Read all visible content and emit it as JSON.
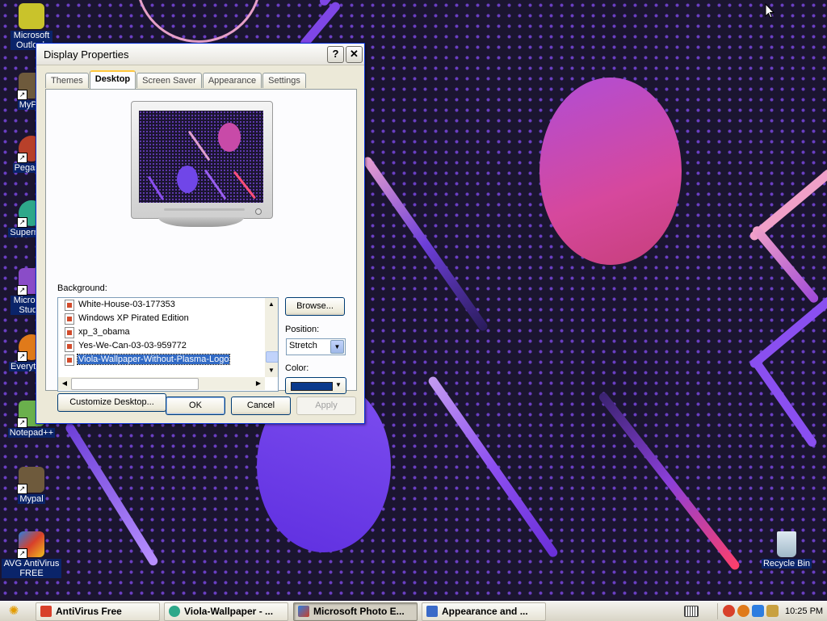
{
  "desktop": {
    "icons": [
      {
        "label": "Microsoft Outlook",
        "color": "#c9c32b"
      },
      {
        "label": "MyPal",
        "color": "#6e5a3c"
      },
      {
        "label": "Pegasus",
        "color": "#b8402a"
      },
      {
        "label": "Supernova",
        "color": "#2ea88a"
      },
      {
        "label": "Microsoft Studio",
        "color": "#8a4cc8"
      },
      {
        "label": "Everything",
        "color": "#e07a1a"
      },
      {
        "label": "Notepad++",
        "color": "#6ab04c"
      },
      {
        "label": "Mypal",
        "color": "#6e5a3c"
      },
      {
        "label": "AVG AntiVirus FREE",
        "color": "#d8402a"
      },
      {
        "label": "Recycle Bin",
        "color": "#9fb8c8"
      }
    ]
  },
  "dialog": {
    "title": "Display Properties",
    "help_glyph": "?",
    "close_glyph": "✕",
    "tabs": [
      "Themes",
      "Desktop",
      "Screen Saver",
      "Appearance",
      "Settings"
    ],
    "active_tab": "Desktop",
    "background_label": "Background:",
    "backgrounds": [
      "White-House-03-177353",
      "Windows XP Pirated Edition",
      "xp_3_obama",
      "Yes-We-Can-03-03-959772",
      "Viola-Wallpaper-Without-Plasma-Logo"
    ],
    "selected_background": "Viola-Wallpaper-Without-Plasma-Logo",
    "browse_label": "Browse...",
    "position_label": "Position:",
    "position_value": "Stretch",
    "color_label": "Color:",
    "color_value": "#0a3a8c",
    "customize_label": "Customize Desktop...",
    "ok_label": "OK",
    "cancel_label": "Cancel",
    "apply_label": "Apply"
  },
  "taskbar": {
    "tasks": [
      {
        "label": "AntiVirus Free",
        "active": false,
        "icon": "#d8402a"
      },
      {
        "label": "Viola-Wallpaper - ...",
        "active": false,
        "icon": "#2ea88a"
      },
      {
        "label": "Microsoft Photo E...",
        "active": true,
        "icon": "#c8402a"
      },
      {
        "label": "Appearance and ...",
        "active": false,
        "icon": "#3a6ac8"
      }
    ],
    "clock": "10:25 PM",
    "tray_icons": [
      "keyboard-icon",
      "antivirus-tray-icon",
      "search-tray-icon",
      "network-tray-icon",
      "volume-tray-icon"
    ]
  },
  "colors": {
    "titlebar_border": "#0831d9",
    "selection": "#316ac5",
    "tab_highlight": "#ffc73c"
  }
}
